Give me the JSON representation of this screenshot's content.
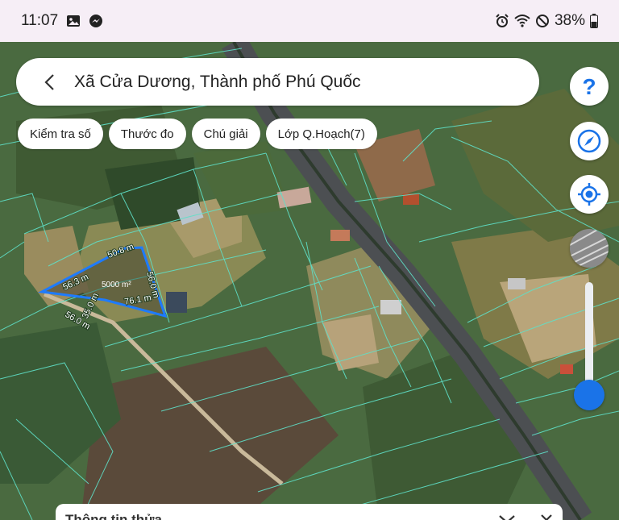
{
  "status_bar": {
    "time": "11:07",
    "battery": "38%",
    "icons": [
      "gallery-icon",
      "messenger-icon",
      "alarm-icon",
      "wifi-icon",
      "no-disturb-icon",
      "battery-icon"
    ]
  },
  "search": {
    "title": "Xã Cửa Dương, Thành phố Phú Quốc"
  },
  "chips": [
    {
      "label": "Kiểm tra số"
    },
    {
      "label": "Thước đo"
    },
    {
      "label": "Chú giải"
    },
    {
      "label": "Lớp Q.Hoạch(7)"
    }
  ],
  "controls": {
    "help_icon": "help-icon",
    "compass_icon": "compass-icon",
    "locate_icon": "my-location-icon",
    "opacity_level": 0.15
  },
  "plot": {
    "edges": [
      "50.8 m",
      "56.3 m",
      "56.0 m",
      "76.1 m",
      "56.0 m",
      "35.0 m"
    ],
    "area": "5000 m²"
  },
  "sheet": {
    "title": "Thông tin thửa"
  },
  "colors": {
    "accent": "#1a73e8",
    "parcel_line": "#5fe0c8",
    "highlight": "#1e7bff",
    "status_bar_bg": "#f6eef6"
  }
}
